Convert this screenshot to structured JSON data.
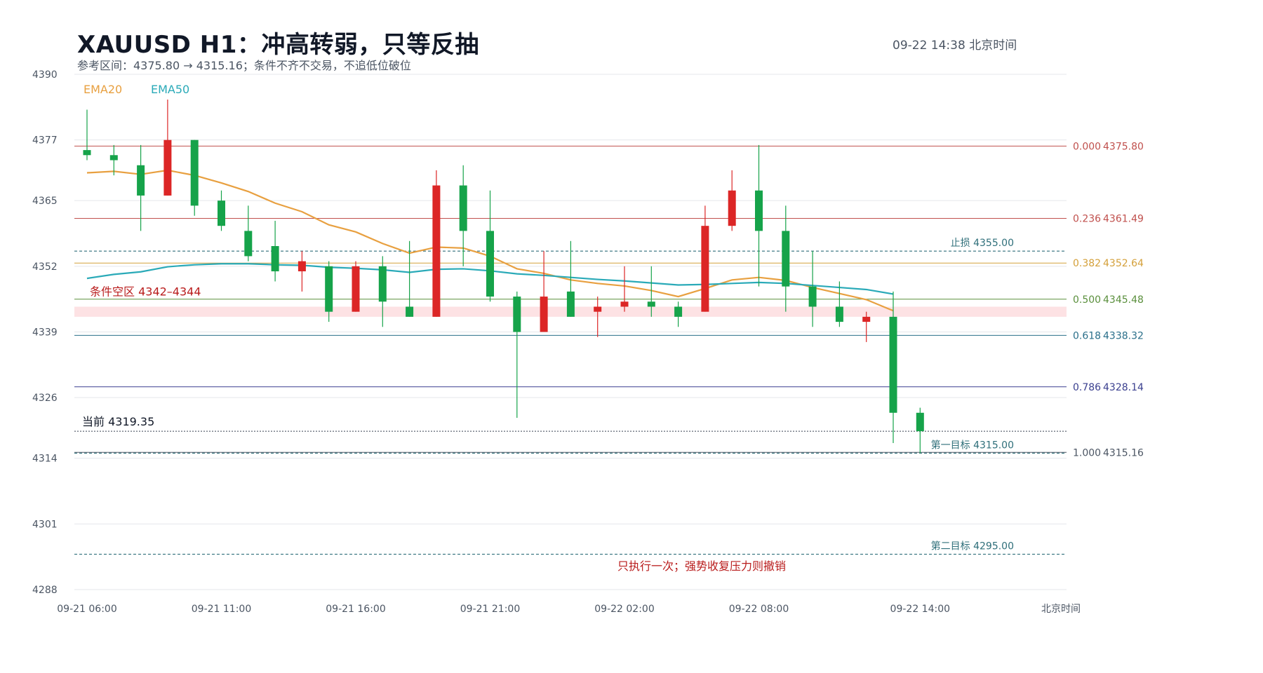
{
  "header": {
    "title": "XAUUSD  H1：冲高转弱，只等反抽",
    "subtitle": "参考区间：4375.80 → 4315.16；条件不齐不交易，不追低位破位",
    "timestamp": "09-22  14:38 北京时间"
  },
  "colors": {
    "up": "#16a34a",
    "down": "#dc2626",
    "ema20": "#e8a040",
    "ema50": "#2aaab8",
    "grid": "#e5e7eb",
    "axis_text": "#4b5563",
    "zone_fill": "#fde2e4",
    "target": "#2f6f7a",
    "note": "#b91c1c"
  },
  "chart_data": {
    "type": "candlestick",
    "y_ticks": [
      4390,
      4377,
      4365,
      4352,
      4339,
      4326,
      4314,
      4301,
      4288
    ],
    "ylim": [
      4288,
      4390
    ],
    "x_axis_unit_label": "北京时间",
    "x_ticks": [
      {
        "label": "09-21 06:00",
        "index": 0
      },
      {
        "label": "09-21 11:00",
        "index": 5
      },
      {
        "label": "09-21 16:00",
        "index": 10
      },
      {
        "label": "09-21 21:00",
        "index": 15
      },
      {
        "label": "09-22 02:00",
        "index": 20
      },
      {
        "label": "09-22 08:00",
        "index": 25
      },
      {
        "label": "09-22 14:00",
        "index": 31
      }
    ],
    "candles": [
      {
        "o": 4374.0,
        "h": 4383.0,
        "l": 4373.0,
        "c": 4375.0
      },
      {
        "o": 4373.0,
        "h": 4376.0,
        "l": 4370.0,
        "c": 4374.0
      },
      {
        "o": 4366.0,
        "h": 4376.0,
        "l": 4359.0,
        "c": 4372.0
      },
      {
        "o": 4377.0,
        "h": 4385.0,
        "l": 4366.0,
        "c": 4366.0
      },
      {
        "o": 4364.0,
        "h": 4377.0,
        "l": 4362.0,
        "c": 4377.0
      },
      {
        "o": 4360.0,
        "h": 4367.0,
        "l": 4359.0,
        "c": 4365.0
      },
      {
        "o": 4354.0,
        "h": 4364.0,
        "l": 4353.0,
        "c": 4359.0
      },
      {
        "o": 4351.0,
        "h": 4361.0,
        "l": 4349.0,
        "c": 4356.0
      },
      {
        "o": 4353.0,
        "h": 4355.0,
        "l": 4347.0,
        "c": 4351.0
      },
      {
        "o": 4343.0,
        "h": 4353.0,
        "l": 4341.0,
        "c": 4352.0
      },
      {
        "o": 4352.0,
        "h": 4353.0,
        "l": 4343.0,
        "c": 4343.0
      },
      {
        "o": 4345.0,
        "h": 4354.0,
        "l": 4340.0,
        "c": 4352.0
      },
      {
        "o": 4342.0,
        "h": 4357.0,
        "l": 4342.0,
        "c": 4344.0
      },
      {
        "o": 4368.0,
        "h": 4371.0,
        "l": 4342.0,
        "c": 4342.0
      },
      {
        "o": 4359.0,
        "h": 4372.0,
        "l": 4352.0,
        "c": 4368.0
      },
      {
        "o": 4346.0,
        "h": 4367.0,
        "l": 4345.0,
        "c": 4359.0
      },
      {
        "o": 4339.0,
        "h": 4347.0,
        "l": 4322.0,
        "c": 4346.0
      },
      {
        "o": 4346.0,
        "h": 4355.0,
        "l": 4339.0,
        "c": 4339.0
      },
      {
        "o": 4342.0,
        "h": 4357.0,
        "l": 4342.0,
        "c": 4347.0
      },
      {
        "o": 4344.0,
        "h": 4346.0,
        "l": 4338.0,
        "c": 4343.0
      },
      {
        "o": 4345.0,
        "h": 4352.0,
        "l": 4343.0,
        "c": 4344.0
      },
      {
        "o": 4344.0,
        "h": 4352.0,
        "l": 4342.0,
        "c": 4345.0
      },
      {
        "o": 4342.0,
        "h": 4345.0,
        "l": 4340.0,
        "c": 4344.0
      },
      {
        "o": 4360.0,
        "h": 4364.0,
        "l": 4343.0,
        "c": 4343.0
      },
      {
        "o": 4367.0,
        "h": 4371.0,
        "l": 4359.0,
        "c": 4360.0
      },
      {
        "o": 4359.0,
        "h": 4376.0,
        "l": 4348.0,
        "c": 4367.0
      },
      {
        "o": 4348.0,
        "h": 4364.0,
        "l": 4343.0,
        "c": 4359.0
      },
      {
        "o": 4344.0,
        "h": 4355.0,
        "l": 4340.0,
        "c": 4348.0
      },
      {
        "o": 4341.0,
        "h": 4349.0,
        "l": 4340.0,
        "c": 4344.0
      },
      {
        "o": 4342.0,
        "h": 4343.0,
        "l": 4337.0,
        "c": 4341.0
      },
      {
        "o": 4323.0,
        "h": 4347.0,
        "l": 4317.0,
        "c": 4342.0
      },
      {
        "o": 4319.35,
        "h": 4324.0,
        "l": 4315.0,
        "c": 4323.0
      }
    ],
    "series": [
      {
        "name": "EMA20",
        "values": [
          4370.5,
          4370.8,
          4370.2,
          4371.0,
          4370.0,
          4368.5,
          4366.8,
          4364.5,
          4362.8,
          4360.2,
          4358.8,
          4356.5,
          4354.6,
          4355.8,
          4355.6,
          4354.0,
          4351.5,
          4350.6,
          4349.3,
          4348.6,
          4348.1,
          4347.2,
          4346.0,
          4347.6,
          4349.3,
          4349.8,
          4349.2,
          4347.8,
          4346.6,
          4345.4,
          4343.2,
          null
        ]
      },
      {
        "name": "EMA50",
        "values": [
          4349.6,
          4350.4,
          4350.9,
          4351.9,
          4352.3,
          4352.5,
          4352.5,
          4352.3,
          4352.2,
          4351.8,
          4351.6,
          4351.3,
          4350.8,
          4351.4,
          4351.5,
          4351.1,
          4350.5,
          4350.2,
          4349.8,
          4349.4,
          4349.1,
          4348.7,
          4348.3,
          4348.4,
          4348.6,
          4348.8,
          4348.6,
          4348.2,
          4347.8,
          4347.4,
          4346.5,
          null
        ]
      }
    ],
    "fib_levels": [
      {
        "ratio": "0.000",
        "price": "4375.80",
        "value": 4375.8,
        "color": "#c0504d"
      },
      {
        "ratio": "0.236",
        "price": "4361.49",
        "value": 4361.49,
        "color": "#c0504d"
      },
      {
        "ratio": "0.382",
        "price": "4352.64",
        "value": 4352.64,
        "color": "#d4a03a"
      },
      {
        "ratio": "0.500",
        "price": "4345.48",
        "value": 4345.48,
        "color": "#5a8f3c"
      },
      {
        "ratio": "0.618",
        "price": "4338.32",
        "value": 4338.32,
        "color": "#2a6f8a"
      },
      {
        "ratio": "0.786",
        "price": "4328.14",
        "value": 4328.14,
        "color": "#3a3f8f"
      },
      {
        "ratio": "1.000",
        "price": "4315.16",
        "value": 4315.16,
        "color": "#4b5563"
      }
    ],
    "levels": [
      {
        "label": "止损 4355.00",
        "value": 4355.0,
        "style": "dashed",
        "color": "#2f6f7a"
      },
      {
        "label": "第一目标 4315.00",
        "value": 4315.0,
        "style": "dashed",
        "color": "#2f6f7a"
      },
      {
        "label": "第二目标 4295.00",
        "value": 4295.0,
        "style": "dashed",
        "color": "#2f6f7a"
      }
    ],
    "current": {
      "label": "当前 4319.35",
      "value": 4319.35
    },
    "zone": {
      "label": "条件空区  4342–4344",
      "low": 4342,
      "high": 4344
    },
    "note": "只执行一次；强势收复压力则撤销",
    "grid": true,
    "legend": "top-left"
  }
}
